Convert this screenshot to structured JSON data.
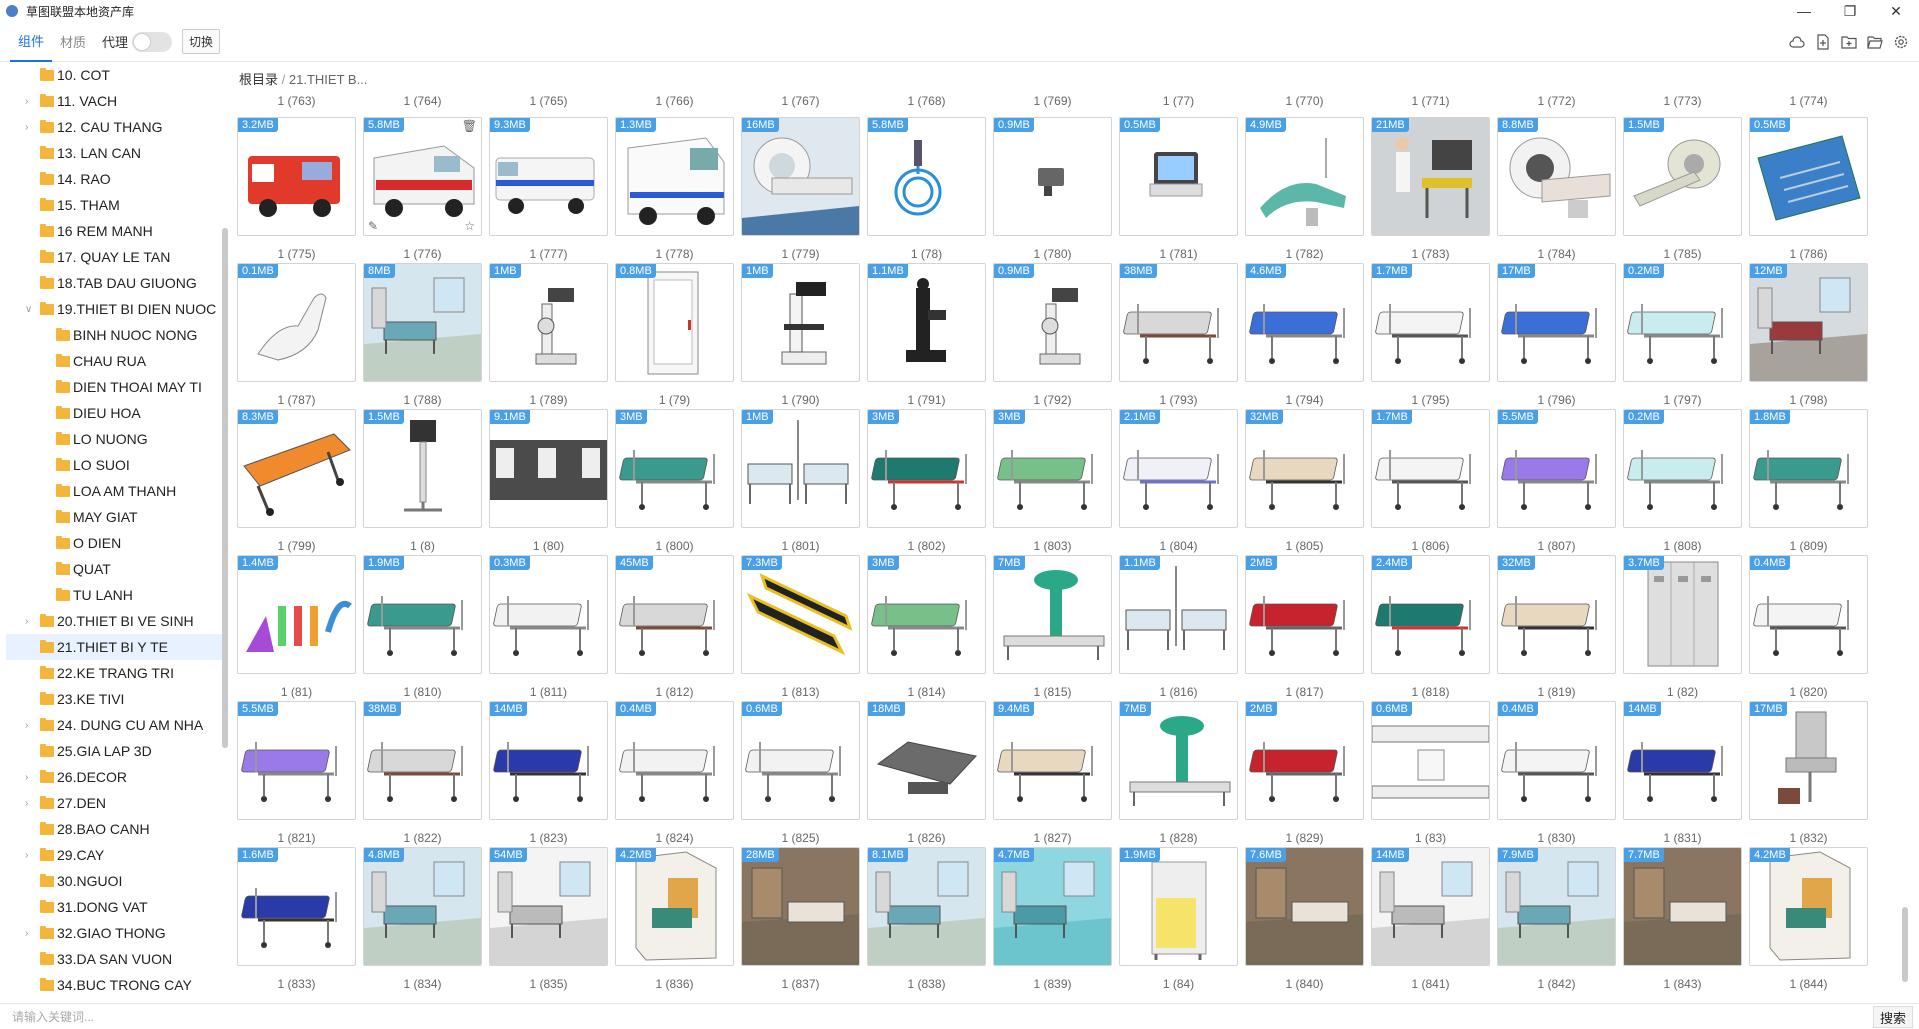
{
  "window": {
    "title": "草图联盟本地资产库"
  },
  "toolbar": {
    "tabs": [
      "组件",
      "材质"
    ],
    "proxy_label": "代理",
    "switch_label": "切换",
    "icons": [
      "cloud-icon",
      "new-file-icon",
      "folder-add-icon",
      "folder-open-icon",
      "settings-icon"
    ]
  },
  "sidebar": {
    "items": [
      {
        "label": "10. COT",
        "depth": 0,
        "caret": false
      },
      {
        "label": "11. VACH",
        "depth": 0,
        "caret": true
      },
      {
        "label": "12. CAU THANG",
        "depth": 0,
        "caret": true
      },
      {
        "label": "13. LAN CAN",
        "depth": 0,
        "caret": false
      },
      {
        "label": "14. RAO",
        "depth": 0,
        "caret": false
      },
      {
        "label": "15. THAM",
        "depth": 0,
        "caret": false
      },
      {
        "label": "16 REM MANH",
        "depth": 0,
        "caret": false
      },
      {
        "label": "17. QUAY LE TAN",
        "depth": 0,
        "caret": false
      },
      {
        "label": "18.TAB DAU GIUONG",
        "depth": 0,
        "caret": false
      },
      {
        "label": "19.THIET BI DIEN NUOC",
        "depth": 0,
        "caret": true,
        "open": true
      },
      {
        "label": "BINH NUOC NONG",
        "depth": 1,
        "caret": false
      },
      {
        "label": "CHAU RUA",
        "depth": 1,
        "caret": false
      },
      {
        "label": "DIEN THOAI MAY TI",
        "depth": 1,
        "caret": false
      },
      {
        "label": "DIEU HOA",
        "depth": 1,
        "caret": false
      },
      {
        "label": "LO NUONG",
        "depth": 1,
        "caret": false
      },
      {
        "label": "LO SUOI",
        "depth": 1,
        "caret": false
      },
      {
        "label": "LOA AM THANH",
        "depth": 1,
        "caret": false
      },
      {
        "label": "MAY GIAT",
        "depth": 1,
        "caret": false
      },
      {
        "label": "O DIEN",
        "depth": 1,
        "caret": false
      },
      {
        "label": "QUAT",
        "depth": 1,
        "caret": false
      },
      {
        "label": "TU LANH",
        "depth": 1,
        "caret": false
      },
      {
        "label": "20.THIET BI VE SINH",
        "depth": 0,
        "caret": true
      },
      {
        "label": "21.THIET BI Y TE",
        "depth": 0,
        "caret": false,
        "selected": true
      },
      {
        "label": "22.KE TRANG TRI",
        "depth": 0,
        "caret": false
      },
      {
        "label": "23.KE TIVI",
        "depth": 0,
        "caret": false
      },
      {
        "label": "24. DUNG CU AM NHA",
        "depth": 0,
        "caret": true
      },
      {
        "label": "25.GIA LAP 3D",
        "depth": 0,
        "caret": false
      },
      {
        "label": "26.DECOR",
        "depth": 0,
        "caret": true
      },
      {
        "label": "27.DEN",
        "depth": 0,
        "caret": true
      },
      {
        "label": "28.BAO CANH",
        "depth": 0,
        "caret": false
      },
      {
        "label": "29.CAY",
        "depth": 0,
        "caret": true
      },
      {
        "label": "30.NGUOI",
        "depth": 0,
        "caret": false
      },
      {
        "label": "31.DONG VAT",
        "depth": 0,
        "caret": false
      },
      {
        "label": "32.GIAO THONG",
        "depth": 0,
        "caret": true
      },
      {
        "label": "33.DA SAN VUON",
        "depth": 0,
        "caret": false
      },
      {
        "label": "34.BUC TRONG CAY",
        "depth": 0,
        "caret": false
      }
    ]
  },
  "breadcrumb": {
    "root": "根目录",
    "separator": "/",
    "current": "21.THIET B..."
  },
  "top_labels": [
    "1 (763)",
    "1 (764)",
    "1 (765)",
    "1 (766)",
    "1 (767)",
    "1 (768)",
    "1 (769)",
    "1 (77)",
    "1 (770)",
    "1 (771)",
    "1 (772)",
    "1 (773)",
    "1 (774)"
  ],
  "grid": {
    "rows": [
      [
        {
          "size": "3.2MB",
          "label": "1 (775)",
          "kind": "ambulance"
        },
        {
          "size": "5.8MB",
          "label": "1 (776)",
          "kind": "ambulance2"
        },
        {
          "size": "9.3MB",
          "label": "1 (777)",
          "kind": "ambulance3"
        },
        {
          "size": "1.3MB",
          "label": "1 (778)",
          "kind": "ambulance4"
        },
        {
          "size": "16MB",
          "label": "1 (779)",
          "kind": "scanner"
        },
        {
          "size": "5.8MB",
          "label": "1 (78)",
          "kind": "hose"
        },
        {
          "size": "0.9MB",
          "label": "1 (780)",
          "kind": "small"
        },
        {
          "size": "0.5MB",
          "label": "1 (781)",
          "kind": "monitor"
        },
        {
          "size": "4.9MB",
          "label": "1 (782)",
          "kind": "chair"
        },
        {
          "size": "21MB",
          "label": "1 (783)",
          "kind": "doctor"
        },
        {
          "size": "8.8MB",
          "label": "1 (784)",
          "kind": "ct"
        },
        {
          "size": "1.5MB",
          "label": "1 (785)",
          "kind": "ct2"
        },
        {
          "size": "0.5MB",
          "label": "1 (786)",
          "kind": "tray"
        }
      ],
      [
        {
          "size": "0.1MB",
          "label": "1 (787)",
          "kind": "dentalchair"
        },
        {
          "size": "8MB",
          "label": "1 (788)",
          "kind": "room"
        },
        {
          "size": "1MB",
          "label": "1 (789)",
          "kind": "microscope"
        },
        {
          "size": "0.8MB",
          "label": "1 (79)",
          "kind": "cabinet"
        },
        {
          "size": "1MB",
          "label": "1 (790)",
          "kind": "microscope2"
        },
        {
          "size": "1.1MB",
          "label": "1 (791)",
          "kind": "microscope3"
        },
        {
          "size": "0.9MB",
          "label": "1 (792)",
          "kind": "microscope"
        },
        {
          "size": "38MB",
          "label": "1 (793)",
          "kind": "bedgrey"
        },
        {
          "size": "4.6MB",
          "label": "1 (794)",
          "kind": "bedblue"
        },
        {
          "size": "1.7MB",
          "label": "1 (795)",
          "kind": "bedwhite"
        },
        {
          "size": "17MB",
          "label": "1 (796)",
          "kind": "bedblue"
        },
        {
          "size": "0.2MB",
          "label": "1 (797)",
          "kind": "stretcher"
        },
        {
          "size": "12MB",
          "label": "1 (798)",
          "kind": "roomred"
        }
      ],
      [
        {
          "size": "8.3MB",
          "label": "1 (799)",
          "kind": "orange"
        },
        {
          "size": "1.5MB",
          "label": "1 (8)",
          "kind": "stand"
        },
        {
          "size": "9.1MB",
          "label": "1 (80)",
          "kind": "panels"
        },
        {
          "size": "3MB",
          "label": "1 (800)",
          "kind": "bedteal"
        },
        {
          "size": "1MB",
          "label": "1 (801)",
          "kind": "beds2"
        },
        {
          "size": "3MB",
          "label": "1 (802)",
          "kind": "bedtealred"
        },
        {
          "size": "3MB",
          "label": "1 (803)",
          "kind": "bedgreen"
        },
        {
          "size": "2.1MB",
          "label": "1 (804)",
          "kind": "bedpurpleout"
        },
        {
          "size": "32MB",
          "label": "1 (805)",
          "kind": "bedtan"
        },
        {
          "size": "1.7MB",
          "label": "1 (806)",
          "kind": "bedwhite"
        },
        {
          "size": "5.5MB",
          "label": "1 (807)",
          "kind": "bedpurple"
        },
        {
          "size": "0.2MB",
          "label": "1 (808)",
          "kind": "stretcher"
        },
        {
          "size": "1.8MB",
          "label": "1 (809)",
          "kind": "bedteal"
        }
      ],
      [
        {
          "size": "1.4MB",
          "label": "1 (81)",
          "kind": "tubes"
        },
        {
          "size": "1.9MB",
          "label": "1 (810)",
          "kind": "bedteal"
        },
        {
          "size": "0.3MB",
          "label": "1 (811)",
          "kind": "stretcherw"
        },
        {
          "size": "45MB",
          "label": "1 (812)",
          "kind": "bedgrey"
        },
        {
          "size": "7.3MB",
          "label": "1 (813)",
          "kind": "blackyellow"
        },
        {
          "size": "3MB",
          "label": "1 (814)",
          "kind": "bedgreen"
        },
        {
          "size": "7MB",
          "label": "1 (815)",
          "kind": "xray"
        },
        {
          "size": "1.1MB",
          "label": "1 (816)",
          "kind": "beds2"
        },
        {
          "size": "2MB",
          "label": "1 (817)",
          "kind": "bedred"
        },
        {
          "size": "2.4MB",
          "label": "1 (818)",
          "kind": "bedtealred"
        },
        {
          "size": "32MB",
          "label": "1 (819)",
          "kind": "bedtan"
        },
        {
          "size": "3.7MB",
          "label": "1 (82)",
          "kind": "lockers"
        },
        {
          "size": "0.4MB",
          "label": "1 (820)",
          "kind": "bedwhite"
        }
      ],
      [
        {
          "size": "5.5MB",
          "label": "1 (821)",
          "kind": "bedpurple"
        },
        {
          "size": "38MB",
          "label": "1 (822)",
          "kind": "bedgrey"
        },
        {
          "size": "14MB",
          "label": "1 (823)",
          "kind": "bednavy"
        },
        {
          "size": "0.4MB",
          "label": "1 (824)",
          "kind": "stretcherw"
        },
        {
          "size": "0.6MB",
          "label": "1 (825)",
          "kind": "stretcherw"
        },
        {
          "size": "18MB",
          "label": "1 (826)",
          "kind": "recliner"
        },
        {
          "size": "9.4MB",
          "label": "1 (827)",
          "kind": "bedtan"
        },
        {
          "size": "7MB",
          "label": "1 (828)",
          "kind": "xray"
        },
        {
          "size": "2MB",
          "label": "1 (829)",
          "kind": "bedred"
        },
        {
          "size": "0.6MB",
          "label": "1 (83)",
          "kind": "panel"
        },
        {
          "size": "0.4MB",
          "label": "1 (830)",
          "kind": "bedwhite"
        },
        {
          "size": "14MB",
          "label": "1 (831)",
          "kind": "bednavy"
        },
        {
          "size": "17MB",
          "label": "1 (832)",
          "kind": "gynchair"
        }
      ],
      [
        {
          "size": "1.6MB",
          "label": "1 (833)",
          "kind": "bednavy"
        },
        {
          "size": "4.8MB",
          "label": "1 (834)",
          "kind": "room"
        },
        {
          "size": "54MB",
          "label": "1 (835)",
          "kind": "roomwhite"
        },
        {
          "size": "4.2MB",
          "label": "1 (836)",
          "kind": "roombox"
        },
        {
          "size": "28MB",
          "label": "1 (837)",
          "kind": "roomwood"
        },
        {
          "size": "8.1MB",
          "label": "1 (838)",
          "kind": "room"
        },
        {
          "size": "4.7MB",
          "label": "1 (839)",
          "kind": "roomcyan"
        },
        {
          "size": "1.9MB",
          "label": "1 (84)",
          "kind": "screen"
        },
        {
          "size": "7.6MB",
          "label": "1 (840)",
          "kind": "roomwood"
        },
        {
          "size": "14MB",
          "label": "1 (841)",
          "kind": "roomwhite"
        },
        {
          "size": "7.9MB",
          "label": "1 (842)",
          "kind": "room"
        },
        {
          "size": "7.7MB",
          "label": "1 (843)",
          "kind": "roomwood"
        },
        {
          "size": "4.2MB",
          "label": "1 (844)",
          "kind": "roombox"
        }
      ]
    ]
  },
  "search": {
    "placeholder": "请输入关键词...",
    "button": "搜索"
  },
  "colors": {
    "accent": "#1e6fe8",
    "badge": "#4aa0e6",
    "folder": "#f4b63a"
  }
}
